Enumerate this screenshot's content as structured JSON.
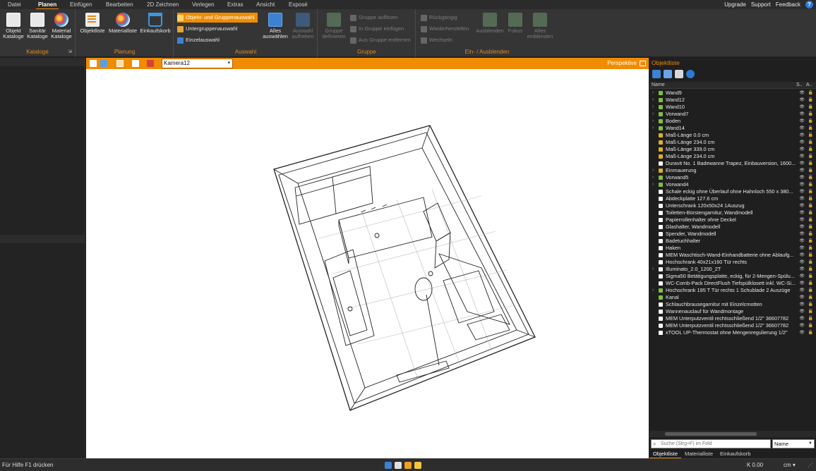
{
  "menu": {
    "items": [
      "Datei",
      "Planen",
      "Einfügen",
      "Bearbeiten",
      "2D Zeichnen",
      "Verlegen",
      "Extras",
      "Ansicht",
      "Exposé"
    ],
    "active": "Planen",
    "right_links": [
      "Upgrade",
      "Support",
      "Feedback"
    ]
  },
  "ribbon": {
    "kataloge": {
      "label": "Kataloge",
      "buttons": [
        {
          "line1": "Objekt",
          "line2": "Kataloge"
        },
        {
          "line1": "Sanitär",
          "line2": "Kataloge"
        },
        {
          "line1": "Material",
          "line2": "Kataloge"
        }
      ]
    },
    "planung": {
      "label": "Planung",
      "buttons": [
        "Objektliste",
        "Materialliste",
        "Einkaufskorb"
      ]
    },
    "auswahl": {
      "label": "Auswahl",
      "modes": [
        "Objekt- und Gruppenauswahl",
        "Untergruppenauswahl",
        "Einzelauswahl"
      ],
      "select_all": {
        "line1": "Alles",
        "line2": "auswählen"
      },
      "clear": {
        "line1": "Auswahl",
        "line2": "aufheben"
      }
    },
    "gruppe": {
      "label": "Gruppe",
      "define": {
        "line1": "Gruppe",
        "line2": "definieren"
      },
      "actions": [
        "Gruppe auflösen",
        "In Gruppe einfügen",
        "Aus Gruppe entfernen"
      ]
    },
    "einblenden": {
      "label": "Ein- / Ausblenden",
      "actions": [
        "Rückgängig",
        "Wiederherstellen",
        "Wechseln"
      ],
      "hide": "Ausblenden",
      "focus": "Fokus",
      "show_all": {
        "line1": "Alles",
        "line2": "einblenden"
      }
    }
  },
  "viewport": {
    "camera": "Kamera12",
    "projection": "Perspektive"
  },
  "object_list": {
    "title": "Objektliste",
    "columns": {
      "name": "Name",
      "s": "S..",
      "a": "A.."
    },
    "items": [
      {
        "expandable": true,
        "icon": "#7fbf3f",
        "name": "Wand9"
      },
      {
        "expandable": true,
        "icon": "#7fbf3f",
        "name": "Wand12"
      },
      {
        "expandable": true,
        "icon": "#7fbf3f",
        "name": "Wand10"
      },
      {
        "expandable": true,
        "icon": "#7fbf3f",
        "name": "Vorwand7"
      },
      {
        "expandable": true,
        "icon": "#7fbf3f",
        "name": "Boden"
      },
      {
        "expandable": true,
        "icon": "#7fbf3f",
        "name": "Wand14"
      },
      {
        "expandable": false,
        "icon": "#e0b020",
        "name": "Maß-Länge 0.0 cm"
      },
      {
        "expandable": false,
        "icon": "#e0b020",
        "name": "Maß-Länge 234.0 cm"
      },
      {
        "expandable": false,
        "icon": "#e0b020",
        "name": "Maß-Länge 339.0 cm"
      },
      {
        "expandable": false,
        "icon": "#e0b020",
        "name": "Maß-Länge 234.0 cm"
      },
      {
        "expandable": false,
        "icon": "#ffffff",
        "name": "Duravit No. 1 Badewanne Trapez, Einbauversion, 1600..."
      },
      {
        "expandable": true,
        "icon": "#e0b020",
        "name": "Einmauerung"
      },
      {
        "expandable": true,
        "icon": "#7fbf3f",
        "name": "Vorwand5"
      },
      {
        "expandable": true,
        "icon": "#7fbf3f",
        "name": "Vorwand4"
      },
      {
        "expandable": false,
        "icon": "#ffffff",
        "name": "Schale eckig ohne Überlauf ohne Hahnloch 550 x 380..."
      },
      {
        "expandable": false,
        "icon": "#ffffff",
        "name": "Abdeckplatte 127.6 cm"
      },
      {
        "expandable": false,
        "icon": "#ffffff",
        "name": "Unterschrank 120x50x24 1Auszug"
      },
      {
        "expandable": false,
        "icon": "#ffffff",
        "name": "Toiletten-Bürstengarnitur, Wandmodell"
      },
      {
        "expandable": false,
        "icon": "#ffffff",
        "name": "Papierrollenhalter ohne Deckel"
      },
      {
        "expandable": false,
        "icon": "#ffffff",
        "name": "Glashalter, Wandmodell"
      },
      {
        "expandable": false,
        "icon": "#ffffff",
        "name": "Spender, Wandmodell"
      },
      {
        "expandable": false,
        "icon": "#ffffff",
        "name": "Badetuchhalter"
      },
      {
        "expandable": false,
        "icon": "#ffffff",
        "name": "Haken"
      },
      {
        "expandable": false,
        "icon": "#ffffff",
        "name": "MEM Waschtisch-Wand-Einhandbatterie ohne Ablaufg..."
      },
      {
        "expandable": false,
        "icon": "#ffffff",
        "name": "Hochschrank 40x21x160 Tür rechts"
      },
      {
        "expandable": true,
        "icon": "#ffffff",
        "name": "Illuminato_2.0_1200_2T"
      },
      {
        "expandable": false,
        "icon": "#ffffff",
        "name": "Sigma50 Betätigungsplatte, eckig, für 2-Mengen-Spülu..."
      },
      {
        "expandable": false,
        "icon": "#ffffff",
        "name": "WC-Comb-Pack DirectFlush Tiefspülklosett inkl. WC-Si..."
      },
      {
        "expandable": true,
        "icon": "#7fbf3f",
        "name": "Hochschrank 195 T Tür rechts 1 Schublade 2 Auszüge"
      },
      {
        "expandable": false,
        "icon": "#7fbf3f",
        "name": "Kanal"
      },
      {
        "expandable": false,
        "icon": "#ffffff",
        "name": "Schlauchbrausegarnitur mit Einzelcmotten"
      },
      {
        "expandable": false,
        "icon": "#ffffff",
        "name": "Wannenauslauf für Wandmontage"
      },
      {
        "expandable": false,
        "icon": "#ffffff",
        "name": "MEM Unterputzventil rechtsschließend 1/2\" 36607782"
      },
      {
        "expandable": false,
        "icon": "#ffffff",
        "name": "MEM Unterputzventil rechtsschließend 1/2\" 36607782"
      },
      {
        "expandable": false,
        "icon": "#ffffff",
        "name": "xTOOL UP-Thermostat ohne Mengenregulierung 1/2\""
      }
    ],
    "search_placeholder": "Suche (Strg+F) im Feld",
    "search_field": "Name",
    "tabs": [
      "Objektliste",
      "Materialliste",
      "Einkaufskorb"
    ]
  },
  "status": {
    "help": "Für Hilfe F1 drücken",
    "k_value": "K 0.00",
    "unit": "cm"
  },
  "colors": {
    "accent": "#f08c00",
    "panel": "#1f1f1f"
  }
}
